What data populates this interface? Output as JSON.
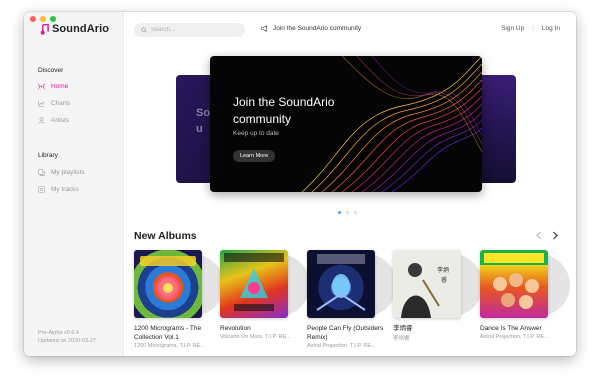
{
  "app": {
    "name": "SoundArio",
    "brand_color": "#e0179b"
  },
  "sidebar": {
    "discover_heading": "Discover",
    "discover_items": [
      {
        "label": "Home",
        "icon": "radio-icon",
        "active": true
      },
      {
        "label": "Charts",
        "icon": "chart-icon",
        "active": false
      },
      {
        "label": "Artists",
        "icon": "user-icon",
        "active": false
      }
    ],
    "library_heading": "Library",
    "library_items": [
      {
        "label": "My playlists",
        "icon": "playlist-icon"
      },
      {
        "label": "My tracks",
        "icon": "tracks-icon"
      }
    ],
    "version": "Pre-Alpha v0.6.4",
    "updated": "Updated on 2020-03-27"
  },
  "topbar": {
    "search_placeholder": "Search...",
    "community_label": "Join the SoundArio community",
    "sign_up": "Sign Up",
    "separator": "|",
    "log_in": "Log In"
  },
  "banner": {
    "title_line1": "Join the SoundArio",
    "title_line2": "community",
    "subtitle": "Keep up to date",
    "button": "Learn More",
    "left_ghost_line1": "So",
    "left_ghost_line2": "u"
  },
  "albums": {
    "title": "New Albums",
    "items": [
      {
        "name": "1200 Micrograms - The Collection Vol.1",
        "artist": "1200 Micrograms, T.I.P. RE..."
      },
      {
        "name": "Revolution",
        "artist": "Volcano On Mars, T.I.P. RE..."
      },
      {
        "name": "People Can Fly (Outsiders Remix)",
        "artist": "Astral Projection, T.I.P. RE..."
      },
      {
        "name": "李炳睿",
        "artist": "李炳睿"
      },
      {
        "name": "Dance Is The Answer",
        "artist": "Astral Projection, T.I.P. RE..."
      }
    ]
  }
}
